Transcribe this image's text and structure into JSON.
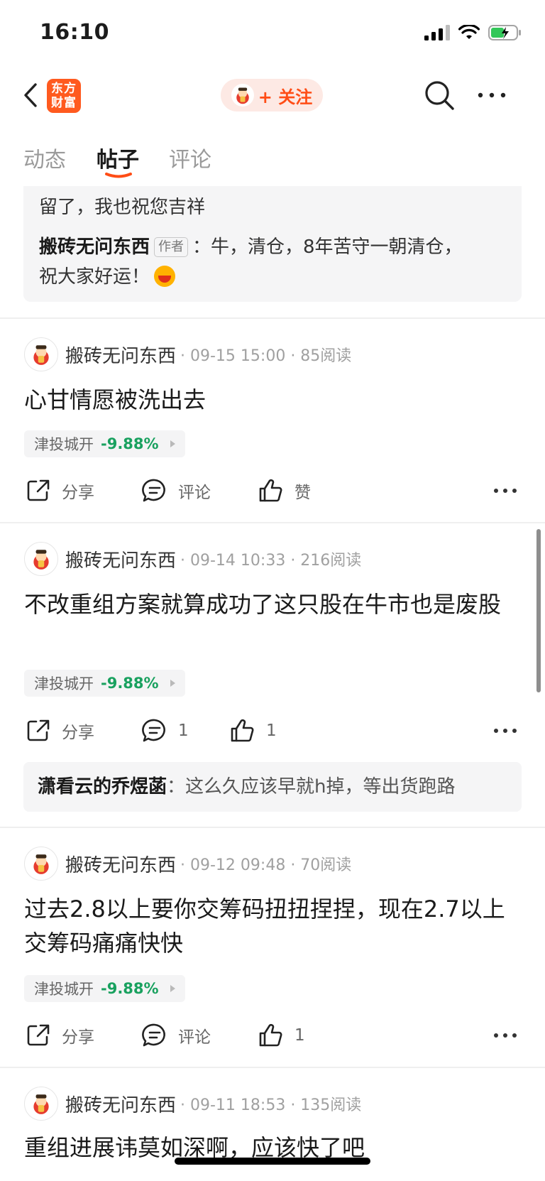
{
  "status_bar": {
    "time": "16:10"
  },
  "header": {
    "logo_text": "东方财富",
    "follow_label": "+ 关注"
  },
  "tabs": [
    {
      "label": "动态",
      "active": false
    },
    {
      "label": "帖子",
      "active": true
    },
    {
      "label": "评论",
      "active": false
    }
  ],
  "quote": {
    "line1": "留了，我也祝您吉祥",
    "author": "搬砖无问东西",
    "author_tag": "作者",
    "text": "：牛，清仓，8年苦守一朝清仓，",
    "line3": "祝大家好运！"
  },
  "posts": [
    {
      "author": "搬砖无问东西",
      "meta": "· 09-15 15:00 · 85阅读",
      "title": "心甘情愿被洗出去",
      "stock": {
        "name": "津投城开",
        "change": "-9.88%"
      },
      "share": "分享",
      "comment": "评论",
      "like": "赞"
    },
    {
      "author": "搬砖无问东西",
      "meta": "· 09-14 10:33 · 216阅读",
      "title": "不改重组方案就算成功了这只股在牛市也是废股",
      "stock": {
        "name": "津投城开",
        "change": "-9.88%"
      },
      "share": "分享",
      "comment": "1",
      "like": "1",
      "reply": {
        "user": "潇看云的乔煜菡",
        "text": "：这么久应该早就h掉，等出货跑路"
      }
    },
    {
      "author": "搬砖无问东西",
      "meta": "· 09-12 09:48 · 70阅读",
      "title": "过去2.8以上要你交筹码扭扭捏捏，现在2.7以上交筹码痛痛快快",
      "stock": {
        "name": "津投城开",
        "change": "-9.88%"
      },
      "share": "分享",
      "comment": "评论",
      "like": "1"
    },
    {
      "author": "搬砖无问东西",
      "meta": "· 09-11 18:53 · 135阅读",
      "title": "重组进展讳莫如深啊，应该快了吧"
    }
  ],
  "colors": {
    "accent": "#ff4d16",
    "down": "#19a15f"
  }
}
